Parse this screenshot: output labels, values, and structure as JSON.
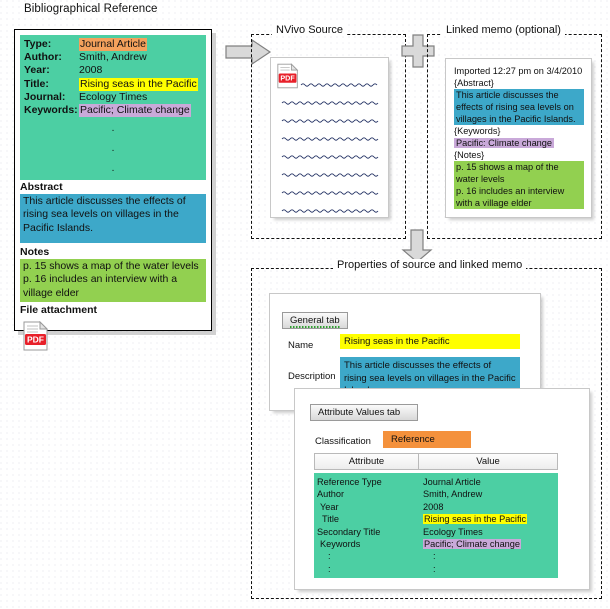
{
  "diagram": {
    "title": "Bibliographical Reference"
  },
  "reference_card": {
    "fields": [
      {
        "label": "Type:",
        "value": "Journal Article",
        "highlight": "orange"
      },
      {
        "label": "Author:",
        "value": "Smith, Andrew",
        "highlight": "none"
      },
      {
        "label": "Year:",
        "value": "2008",
        "highlight": "none"
      },
      {
        "label": "Title:",
        "value": "Rising seas in the Pacific",
        "highlight": "yellow"
      },
      {
        "label": "Journal:",
        "value": "Ecology Times",
        "highlight": "none"
      },
      {
        "label": "Keywords:",
        "value": "Pacific; Climate change",
        "highlight": "purple"
      }
    ],
    "ellipsis": ".",
    "abstract_heading": "Abstract",
    "abstract_text": "This article discusses the effects of rising sea levels on villages in the Pacific Islands.",
    "notes_heading": "Notes",
    "notes_line1": "p. 15 shows a map of the water levels",
    "notes_line2": "p. 16 includes an interview with a village elder",
    "attachment_heading": "File attachment",
    "attachment_icon": "pdf-file-icon"
  },
  "nvivo_source": {
    "group_label": "NVivo Source",
    "page_icon": "pdf-file-icon"
  },
  "linked_memo": {
    "group_label": "Linked memo (optional)",
    "imported_line": "Imported 12:27 pm on 3/4/2010",
    "abstract_tag": "{Abstract}",
    "abstract_text": "This article discusses the effects of rising sea levels on villages in the Pacific Islands.",
    "keywords_tag": "{Keywords}",
    "keywords_text": "Pacific: Climate change",
    "notes_tag": "{Notes}",
    "notes_line1": "p. 15 shows a map of the water levels",
    "notes_line2": "p. 16 includes an interview with a village elder"
  },
  "properties": {
    "group_label": "Properties of source and linked memo",
    "general_tab": {
      "tab_label": "General tab",
      "name_label": "Name",
      "name_value": "Rising seas in the Pacific",
      "description_label": "Description",
      "description_value": "This article discusses the effects of rising sea levels on villages in the Pacific Islands."
    },
    "attribute_values_tab": {
      "tab_label": "Attribute Values tab",
      "classification_label": "Classification",
      "classification_value": "Reference",
      "columns": [
        "Attribute",
        "Value"
      ],
      "rows": [
        {
          "attribute": "Reference Type",
          "value": "Journal Article",
          "highlight": "none"
        },
        {
          "attribute": "Author",
          "value": "Smith, Andrew",
          "highlight": "none"
        },
        {
          "attribute": "Year",
          "value": "2008",
          "highlight": "none"
        },
        {
          "attribute": "Title",
          "value": "Rising seas in the Pacific",
          "highlight": "yellow"
        },
        {
          "attribute": "Secondary Title",
          "value": "Ecology Times",
          "highlight": "none"
        },
        {
          "attribute": "Keywords",
          "value": "Pacific; Climate change",
          "highlight": "purple"
        },
        {
          "attribute": ":",
          "value": ":",
          "highlight": "none"
        },
        {
          "attribute": ":",
          "value": ":",
          "highlight": "none"
        }
      ]
    }
  },
  "connectors": {
    "import_arrow": "right-arrow-icon",
    "plus_connector": "plus-icon",
    "down_arrow": "down-arrow-icon"
  },
  "colors": {
    "mint": "#4ccfa3",
    "blue": "#3da8c9",
    "green": "#92d050",
    "yellow": "#ffff00",
    "purple": "#c9a9d9",
    "orange_field": "#f4a15c",
    "orange_chip": "#f4913c"
  }
}
